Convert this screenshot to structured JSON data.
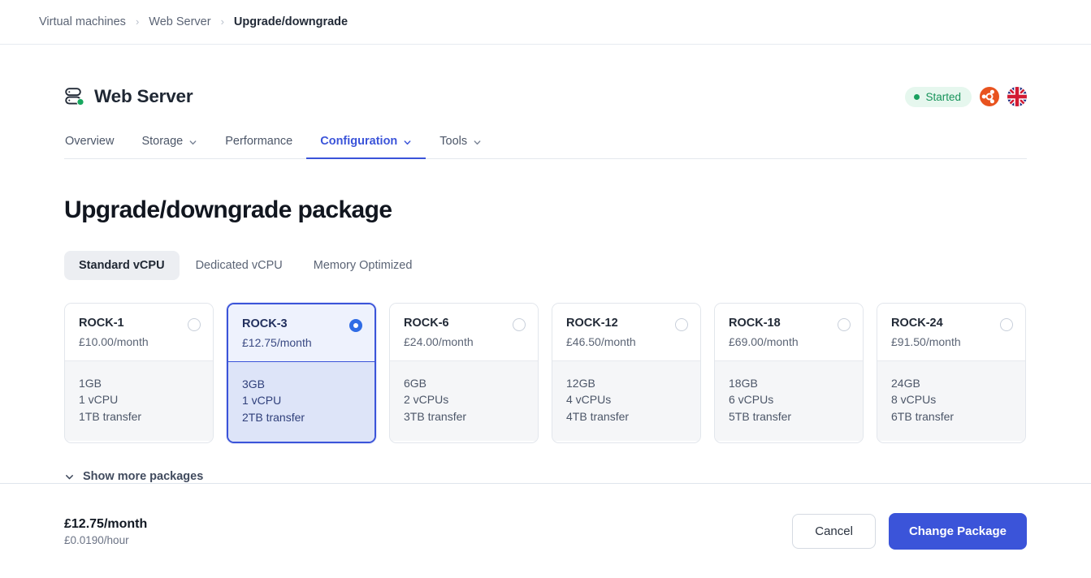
{
  "breadcrumb": {
    "items": [
      {
        "label": "Virtual machines",
        "current": false
      },
      {
        "label": "Web Server",
        "current": false
      },
      {
        "label": "Upgrade/downgrade",
        "current": true
      }
    ],
    "separator": "›"
  },
  "header": {
    "server_name": "Web Server",
    "server_icon": "server-icon",
    "status": {
      "label": "Started",
      "color": "#17935a",
      "background": "#e6f7ee"
    },
    "os_icon": "ubuntu-icon",
    "flag_icon": "uk-flag-icon"
  },
  "tabs": [
    {
      "label": "Overview",
      "active": false,
      "has_chevron": false
    },
    {
      "label": "Storage",
      "active": false,
      "has_chevron": true
    },
    {
      "label": "Performance",
      "active": false,
      "has_chevron": false
    },
    {
      "label": "Configuration",
      "active": true,
      "has_chevron": true
    },
    {
      "label": "Tools",
      "active": false,
      "has_chevron": true
    }
  ],
  "main": {
    "title": "Upgrade/downgrade package",
    "segments": [
      {
        "label": "Standard vCPU",
        "active": true
      },
      {
        "label": "Dedicated vCPU",
        "active": false
      },
      {
        "label": "Memory Optimized",
        "active": false
      }
    ],
    "packages": [
      {
        "name": "ROCK-1",
        "price": "£10.00/month",
        "memory": "1GB",
        "vcpu": "1 vCPU",
        "transfer": "1TB transfer",
        "selected": false
      },
      {
        "name": "ROCK-3",
        "price": "£12.75/month",
        "memory": "3GB",
        "vcpu": "1 vCPU",
        "transfer": "2TB transfer",
        "selected": true
      },
      {
        "name": "ROCK-6",
        "price": "£24.00/month",
        "memory": "6GB",
        "vcpu": "2 vCPUs",
        "transfer": "3TB transfer",
        "selected": false
      },
      {
        "name": "ROCK-12",
        "price": "£46.50/month",
        "memory": "12GB",
        "vcpu": "4 vCPUs",
        "transfer": "4TB transfer",
        "selected": false
      },
      {
        "name": "ROCK-18",
        "price": "£69.00/month",
        "memory": "18GB",
        "vcpu": "6 vCPUs",
        "transfer": "5TB transfer",
        "selected": false
      },
      {
        "name": "ROCK-24",
        "price": "£91.50/month",
        "memory": "24GB",
        "vcpu": "8 vCPUs",
        "transfer": "6TB transfer",
        "selected": false
      }
    ],
    "show_more_label": "Show more packages"
  },
  "footer": {
    "price_month": "£12.75/month",
    "price_hour": "£0.0190/hour",
    "cancel_label": "Cancel",
    "submit_label": "Change Package"
  },
  "colors": {
    "accent": "#3b54d9",
    "radio_selected": "#2f6ce5",
    "status_green": "#1aa05f",
    "selected_card_head": "#eef2fd",
    "selected_card_body": "#dde4f8"
  }
}
